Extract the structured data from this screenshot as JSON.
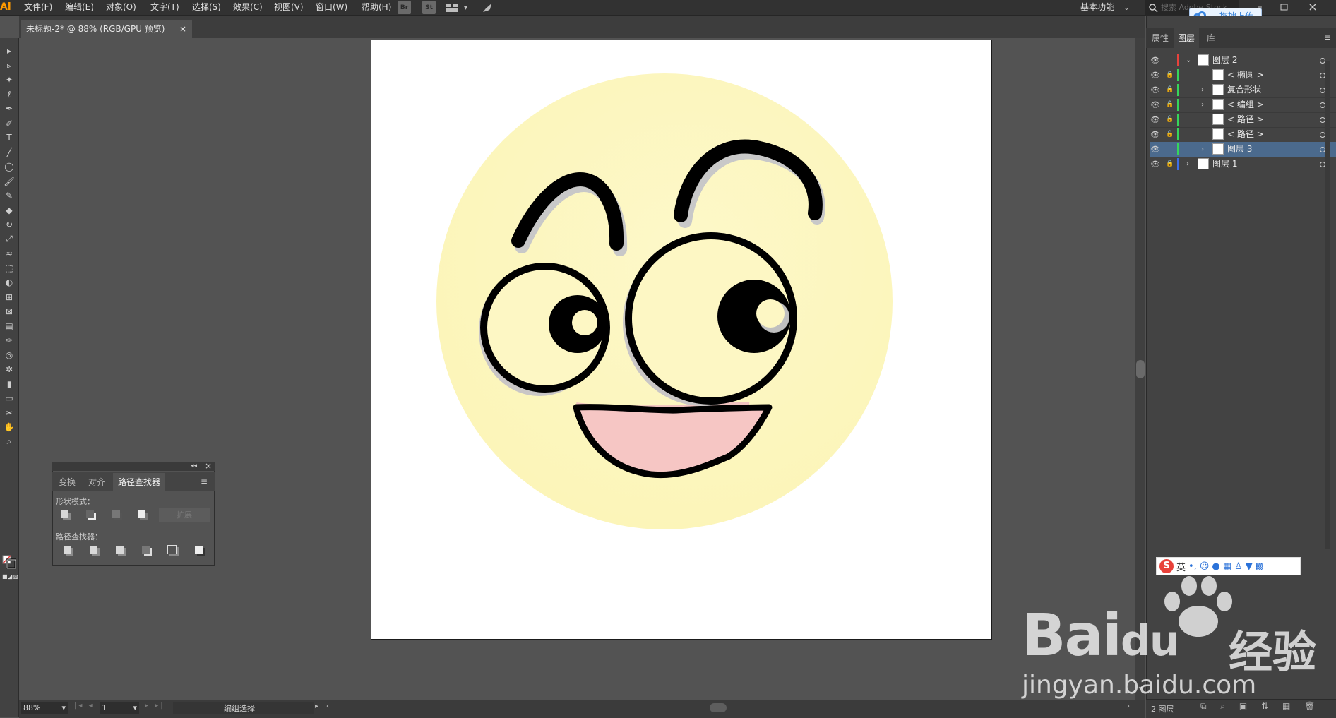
{
  "menubar": {
    "logo": "Ai",
    "items": [
      "文件(F)",
      "编辑(E)",
      "对象(O)",
      "文字(T)",
      "选择(S)",
      "效果(C)",
      "视图(V)",
      "窗口(W)",
      "帮助(H)"
    ],
    "br_label": "Br",
    "st_label": "St",
    "workspace": "基本功能",
    "search_placeholder": "搜索 Adobe Stock"
  },
  "upload": {
    "label": "拖拽上传"
  },
  "document_tab": {
    "title": "未标题-2* @ 88% (RGB/GPU 预览)",
    "close": "×"
  },
  "right_panel": {
    "tabs": [
      "属性",
      "图层",
      "库"
    ],
    "active_tab": "图层",
    "layers": [
      {
        "name": "图层 2",
        "indent": 0,
        "expand": "open",
        "color": "#e8423c",
        "locked": false,
        "selected": false
      },
      {
        "name": "< 椭圆 >",
        "indent": 1,
        "expand": "none",
        "color": "#36d65a",
        "locked": true,
        "selected": false
      },
      {
        "name": "复合形状",
        "indent": 1,
        "expand": "closed",
        "color": "#36d65a",
        "locked": true,
        "selected": false
      },
      {
        "name": "< 编组 >",
        "indent": 1,
        "expand": "closed",
        "color": "#36d65a",
        "locked": true,
        "selected": false
      },
      {
        "name": "< 路径 >",
        "indent": 1,
        "expand": "none",
        "color": "#36d65a",
        "locked": true,
        "selected": false
      },
      {
        "name": "< 路径 >",
        "indent": 1,
        "expand": "none",
        "color": "#36d65a",
        "locked": true,
        "selected": false
      },
      {
        "name": "图层 3",
        "indent": 1,
        "expand": "closed",
        "color": "#36d65a",
        "locked": false,
        "selected": true
      },
      {
        "name": "图层 1",
        "indent": 0,
        "expand": "closed",
        "color": "#3c6ee8",
        "locked": true,
        "selected": false
      }
    ],
    "footer_count": "2 图层"
  },
  "pathfinder": {
    "tabs": [
      "变换",
      "对齐",
      "路径查找器"
    ],
    "active_tab": "路径查找器",
    "shape_modes_label": "形状模式：",
    "expand_label": "扩展",
    "pathfinders_label": "路径查找器："
  },
  "statusbar": {
    "zoom": "88%",
    "artboard": "1",
    "status_text": "编组选择"
  },
  "ime": {
    "lang": "英"
  },
  "watermark": {
    "brand_left": "Bai",
    "brand_du": "du",
    "brand_cn": "经验",
    "url": "jingyan.baidu.com"
  },
  "colors": {
    "face": "#fdf7c4",
    "mouth": "#f6c6c4",
    "stroke": "#000000",
    "selection": "#4b6a8d"
  }
}
